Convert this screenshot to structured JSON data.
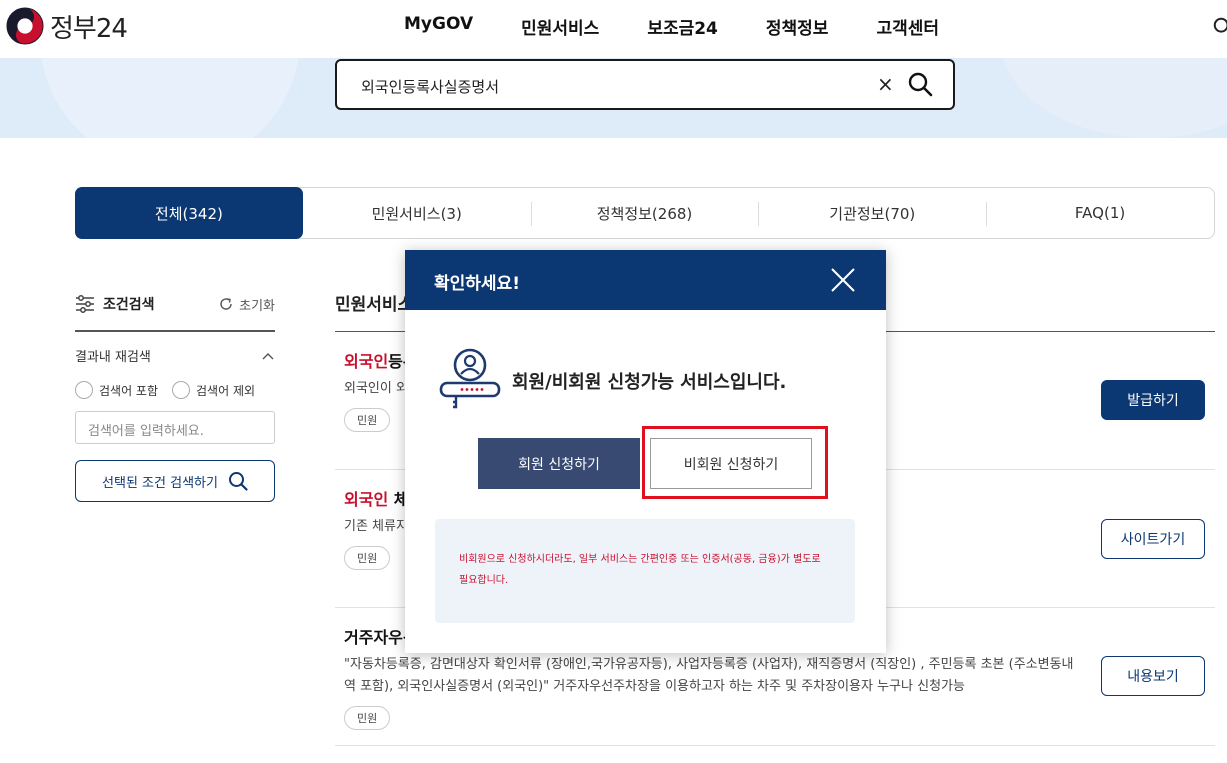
{
  "header": {
    "logo_text": "정부24",
    "nav": [
      "MyGOV",
      "민원서비스",
      "보조금24",
      "정책정보",
      "고객센터"
    ]
  },
  "search": {
    "value": "외국인등록사실증명서",
    "clear_symbol": "×"
  },
  "tabs": [
    {
      "label": "전체(342)",
      "active": true
    },
    {
      "label": "민원서비스(3)",
      "active": false
    },
    {
      "label": "정책정보(268)",
      "active": false
    },
    {
      "label": "기관정보(70)",
      "active": false
    },
    {
      "label": "FAQ(1)",
      "active": false
    }
  ],
  "filter": {
    "title": "조건검색",
    "reset": "초기화",
    "research_label": "결과내 재검색",
    "radio_include": "검색어 포함",
    "radio_exclude": "검색어 제외",
    "input_placeholder": "검색어를 입력하세요.",
    "submit": "선택된 조건 검색하기"
  },
  "results": {
    "section_title": "민원서비스",
    "items": [
      {
        "title_highlight": "외국인",
        "title_rest": "등록",
        "desc": "외국인이 외 … 또는 시.군.구(출장소), 읍.면.동(출장소)에 신 …",
        "tag": "민원",
        "button": "발급하기"
      },
      {
        "title_highlight": "외국인",
        "title_rest": " 체",
        "desc": "기존 체류지 … 이전신고), 외국인등록 사실 증명, 국내 거소 … 외국인 주민의 편의 향상을 도…",
        "tag": "민원",
        "button": "사이트가기"
      },
      {
        "title_highlight": "",
        "title_rest": "거주자우선",
        "desc": "\"자동차등록증, 감면대상자 확인서류 (장애인,국가유공자등), 사업자등록증 (사업자), 재직증명서 (직장인) , 주민등록 초본 (주소변동내역 포함), 외국인사실증명서 (외국인)\" 거주자우선주차장을 이용하고자 하는 차주 및 주차장이용자 누구나 신청가능",
        "tag": "민원",
        "button": "내용보기"
      }
    ]
  },
  "modal": {
    "title": "확인하세요!",
    "message": "회원/비회원 신청가능 서비스입니다.",
    "member_button": "회원 신청하기",
    "guest_button": "비회원 신청하기",
    "notice": "비회원으로 신청하시더라도, 일부 서비스는 간편인증 또는 인증서(공동, 금융)가 별도로 필요합니다."
  },
  "colors": {
    "primary": "#0b3772",
    "highlight_red": "#c8102e",
    "annotation_box": "#e0101e"
  }
}
